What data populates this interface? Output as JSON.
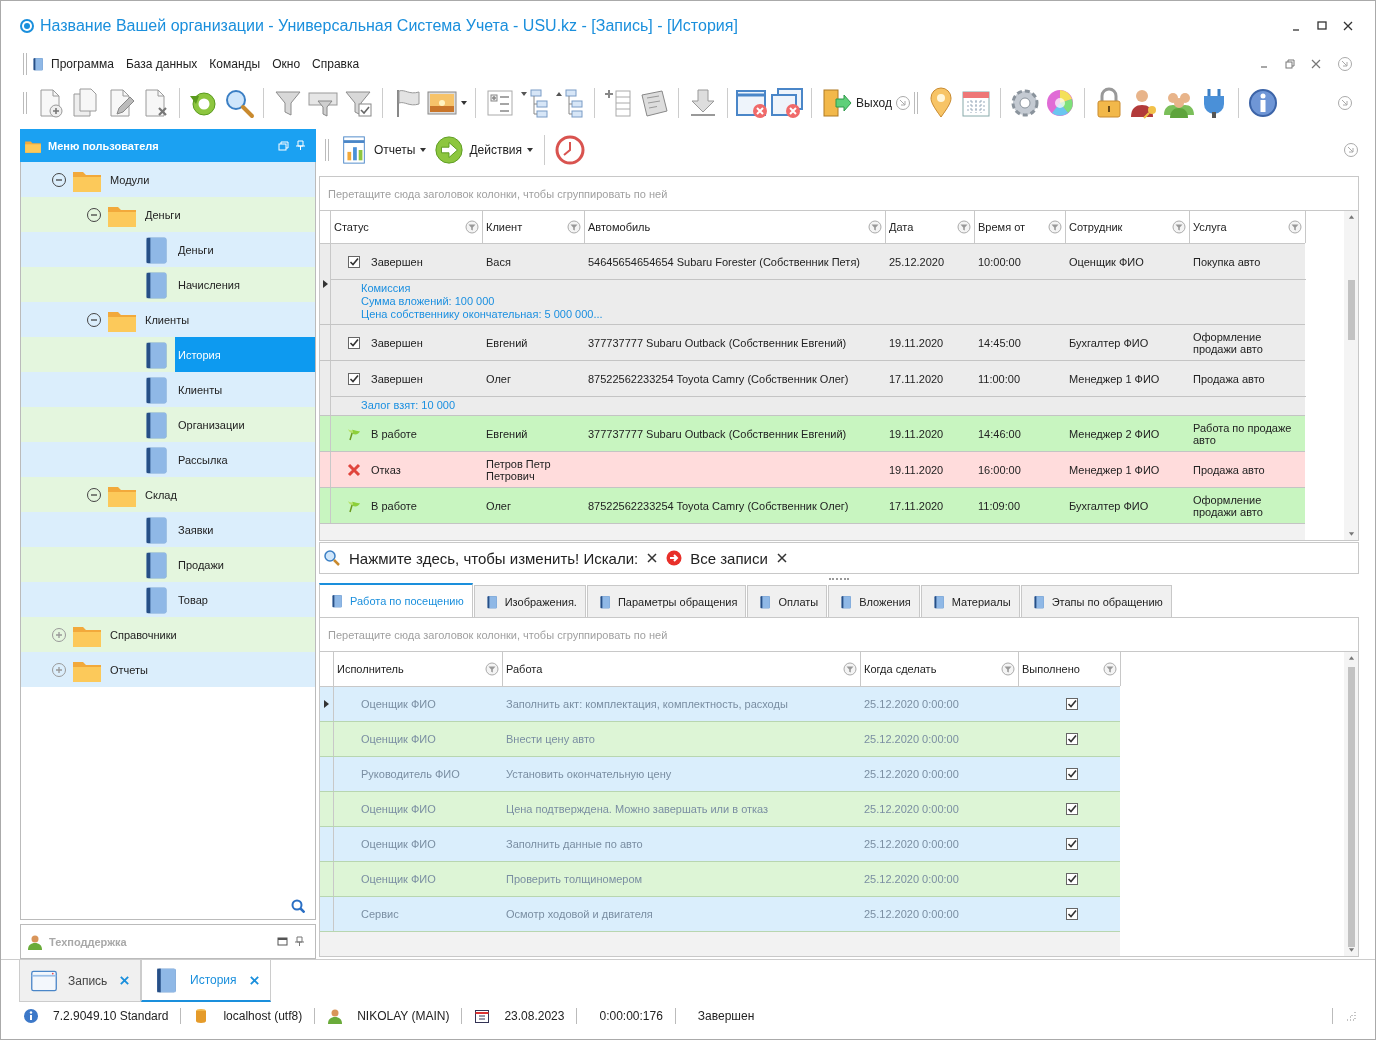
{
  "window": {
    "title": "Название Вашей организации - Универсальная Система Учета - USU.kz - [Запись] - [История]"
  },
  "menu": [
    "Программа",
    "База данных",
    "Команды",
    "Окно",
    "Справка"
  ],
  "toolbar": {
    "exit_label": "Выход"
  },
  "sidebar": {
    "title": "Меню пользователя",
    "tree": [
      {
        "label": "Модули",
        "kind": "folder",
        "expanded": true,
        "selected": false,
        "children": [
          {
            "label": "Деньги",
            "kind": "folder",
            "expanded": true,
            "selected": false,
            "children": [
              {
                "label": "Деньги",
                "kind": "item",
                "selected": false
              },
              {
                "label": "Начисления",
                "kind": "item",
                "selected": false
              }
            ]
          },
          {
            "label": "Клиенты",
            "kind": "folder",
            "expanded": true,
            "selected": false,
            "children": [
              {
                "label": "История",
                "kind": "item",
                "selected": true
              },
              {
                "label": "Клиенты",
                "kind": "item",
                "selected": false
              },
              {
                "label": "Организации",
                "kind": "item",
                "selected": false
              },
              {
                "label": "Рассылка",
                "kind": "item",
                "selected": false
              }
            ]
          },
          {
            "label": "Склад",
            "kind": "folder",
            "expanded": true,
            "selected": false,
            "children": [
              {
                "label": "Заявки",
                "kind": "item",
                "selected": false
              },
              {
                "label": "Продажи",
                "kind": "item",
                "selected": false
              },
              {
                "label": "Товар",
                "kind": "item",
                "selected": false
              }
            ]
          }
        ]
      },
      {
        "label": "Справочники",
        "kind": "folder",
        "expanded": false,
        "selected": false
      },
      {
        "label": "Отчеты",
        "kind": "folder",
        "expanded": false,
        "selected": false
      }
    ],
    "support_title": "Техподдержка"
  },
  "content_toolbar": [
    "Отчеты",
    "Действия"
  ],
  "main_grid": {
    "group_hint": "Перетащите сюда заголовок колонки, чтобы сгруппировать по ней",
    "columns": [
      "Статус",
      "Клиент",
      "Автомобиль",
      "Дата",
      "Время от",
      "Сотрудник",
      "Услуга"
    ],
    "rows": [
      {
        "kind": "done",
        "focused": true,
        "status": "Завершен",
        "client": "Вася",
        "car": "54645654654654 Subaru Forester (Собственник Петя)",
        "date": "25.12.2020",
        "time": "10:00:00",
        "employee": "Оценщик ФИО",
        "service": "Покупка авто",
        "preview": [
          "Комиссия",
          "Сумма вложений:  100 000",
          "Цена собственнику окончательная: 5 000 000..."
        ]
      },
      {
        "kind": "done",
        "focused": false,
        "status": "Завершен",
        "client": "Евгений",
        "car": "377737777 Subaru Outback (Собственник Евгений)",
        "date": "19.11.2020",
        "time": "14:45:00",
        "employee": "Бухгалтер ФИО",
        "service": "Оформление продажи авто"
      },
      {
        "kind": "done",
        "focused": false,
        "status": "Завершен",
        "client": "Олег",
        "car": "87522562233254 Toyota Camry (Собственник Олег)",
        "date": "17.11.2020",
        "time": "11:00:00",
        "employee": "Менеджер 1 ФИО",
        "service": "Продажа авто",
        "preview": [
          "Залог взят: 10 000"
        ]
      },
      {
        "kind": "in_progress",
        "focused": false,
        "status": "В работе",
        "client": "Евгений",
        "car": "377737777 Subaru Outback (Собственник Евгений)",
        "date": "19.11.2020",
        "time": "14:46:00",
        "employee": "Менеджер 2 ФИО",
        "service": "Работа по продаже авто"
      },
      {
        "kind": "rejected",
        "focused": false,
        "status": "Отказ",
        "client": "Петров Петр Петрович",
        "date": "19.11.2020",
        "time": "16:00:00",
        "employee": "Менеджер 1 ФИО",
        "service": "Продажа авто"
      },
      {
        "kind": "in_progress",
        "focused": false,
        "status": "В работе",
        "client": "Олег",
        "car": "87522562233254 Toyota Camry (Собственник Олег)",
        "date": "17.11.2020",
        "time": "11:09:00",
        "employee": "Бухгалтер ФИО",
        "service": "Оформление продажи авто"
      }
    ]
  },
  "find_panel": {
    "prompt": "Нажмите здесь, чтобы изменить! Искали:",
    "filter": "Все записи"
  },
  "detail_tabs": [
    {
      "label": "Работа по посещению",
      "selected": true
    },
    {
      "label": "Изображения.",
      "selected": false
    },
    {
      "label": "Параметры обращения",
      "selected": false
    },
    {
      "label": "Оплаты",
      "selected": false
    },
    {
      "label": "Вложения",
      "selected": false
    },
    {
      "label": "Материалы",
      "selected": false
    },
    {
      "label": "Этапы по обращению",
      "selected": false
    }
  ],
  "detail_grid": {
    "group_hint": "Перетащите сюда заголовок колонки, чтобы сгруппировать по ней",
    "columns": [
      "Исполнитель",
      "Работа",
      "Когда сделать",
      "Выполнено"
    ],
    "rows": [
      {
        "focused": true,
        "executor": "Оценщик ФИО",
        "work": "Заполнить акт: комплектация, комплектность, расходы",
        "due": "25.12.2020 0:00:00",
        "done": true
      },
      {
        "focused": false,
        "executor": "Оценщик ФИО",
        "work": "Внести цену авто",
        "due": "25.12.2020 0:00:00",
        "done": true
      },
      {
        "focused": false,
        "executor": "Руководитель ФИО",
        "work": "Установить окончательную цену",
        "due": "25.12.2020 0:00:00",
        "done": true
      },
      {
        "focused": false,
        "executor": "Оценщик ФИО",
        "work": "Цена подтверждена. Можно завершать или в отказ",
        "due": "25.12.2020 0:00:00",
        "done": true
      },
      {
        "focused": false,
        "executor": "Оценщик ФИО",
        "work": "Заполнить данные по авто",
        "due": "25.12.2020 0:00:00",
        "done": true
      },
      {
        "focused": false,
        "executor": "Оценщик ФИО",
        "work": "Проверить толщиномером",
        "due": "25.12.2020 0:00:00",
        "done": true
      },
      {
        "focused": false,
        "executor": "Сервис",
        "work": "Осмотр ходовой и двигателя",
        "due": "25.12.2020 0:00:00",
        "done": true
      }
    ]
  },
  "doc_tabs": [
    {
      "label": "Запись",
      "selected": false
    },
    {
      "label": "История",
      "selected": true
    }
  ],
  "status_bar": {
    "version": "7.2.9049.10 Standard",
    "database": "localhost (utf8)",
    "user": "NIKOLAY (MAIN)",
    "date": "23.08.2023",
    "elapsed": "0:00:00:176",
    "state": "Завершен"
  }
}
